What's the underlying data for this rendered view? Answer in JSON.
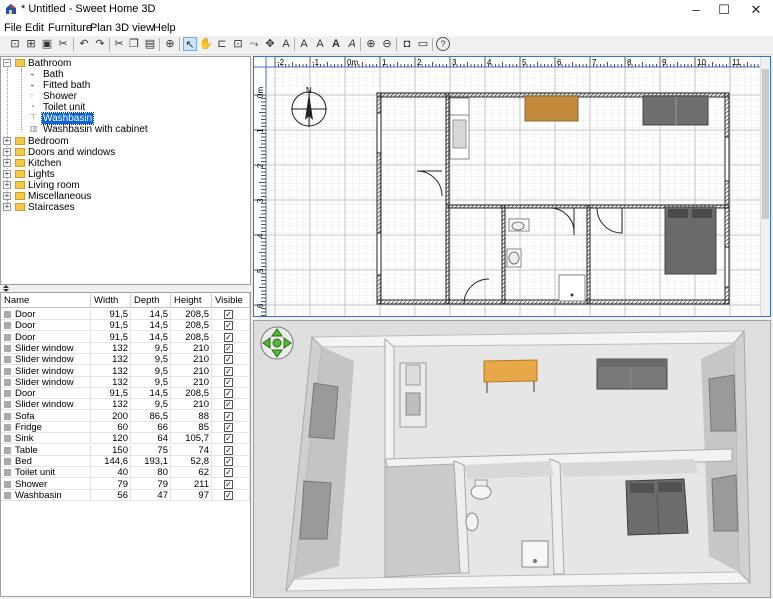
{
  "window": {
    "title": "* Untitled - Sweet Home 3D",
    "minimize": "–",
    "maximize": "☐",
    "close": "✕"
  },
  "menu": [
    "File",
    "Edit",
    "Furniture",
    "Plan",
    "3D view",
    "Help"
  ],
  "toolbar": [
    "new-icon",
    "open-icon",
    "save-icon",
    "cut-icon",
    "undo-icon",
    "redo-icon",
    "add-furniture-icon",
    "select-icon",
    "pan-icon",
    "create-walls-icon",
    "create-rooms-icon",
    "create-dimensions-icon",
    "add-text-icon",
    "zoom-in-icon",
    "zoom-out-icon",
    "camera-icon",
    "help-icon"
  ],
  "catalog": {
    "categories": [
      {
        "label": "Bathroom",
        "expanded": true,
        "items": [
          "Bath",
          "Fitted bath",
          "Shower",
          "Toilet unit",
          "Washbasin",
          "Washbasin with cabinet"
        ]
      },
      {
        "label": "Bedroom"
      },
      {
        "label": "Doors and windows"
      },
      {
        "label": "Kitchen"
      },
      {
        "label": "Lights"
      },
      {
        "label": "Living room"
      },
      {
        "label": "Miscellaneous"
      },
      {
        "label": "Staircases"
      }
    ],
    "selected": "Washbasin"
  },
  "furniture_table": {
    "columns": [
      "Name",
      "Width",
      "Depth",
      "Height",
      "Visible"
    ],
    "rows": [
      [
        "Door",
        "91,5",
        "14,5",
        "208,5",
        "✓"
      ],
      [
        "Door",
        "91,5",
        "14,5",
        "208,5",
        "✓"
      ],
      [
        "Door",
        "91,5",
        "14,5",
        "208,5",
        "✓"
      ],
      [
        "Slider window",
        "132",
        "9,5",
        "210",
        "✓"
      ],
      [
        "Slider window",
        "132",
        "9,5",
        "210",
        "✓"
      ],
      [
        "Slider window",
        "132",
        "9,5",
        "210",
        "✓"
      ],
      [
        "Slider window",
        "132",
        "9,5",
        "210",
        "✓"
      ],
      [
        "Door",
        "91,5",
        "14,5",
        "208,5",
        "✓"
      ],
      [
        "Slider window",
        "132",
        "9,5",
        "210",
        "✓"
      ],
      [
        "Sofa",
        "200",
        "86,5",
        "88",
        "✓"
      ],
      [
        "Fridge",
        "60",
        "66",
        "85",
        "✓"
      ],
      [
        "Sink",
        "120",
        "64",
        "105,7",
        "✓"
      ],
      [
        "Table",
        "150",
        "75",
        "74",
        "✓"
      ],
      [
        "Bed",
        "144,6",
        "193,1",
        "52,8",
        "✓"
      ],
      [
        "Toilet unit",
        "40",
        "80",
        "62",
        "✓"
      ],
      [
        "Shower",
        "79",
        "79",
        "211",
        "✓"
      ],
      [
        "Washbasin",
        "56",
        "47",
        "97",
        "✓"
      ]
    ]
  },
  "plan": {
    "ruler_top": [
      "-2",
      "-1",
      "0m",
      "1",
      "2",
      "3",
      "4",
      "5",
      "6",
      "7",
      "8",
      "9",
      "10",
      "11"
    ],
    "ruler_left": [
      "0m",
      "1",
      "2",
      "3",
      "4",
      "5",
      "6"
    ],
    "compass": "N"
  },
  "colors": {
    "table": "#c08a3a",
    "sofa": "#6e6e6e",
    "bed": "#6a6a6a",
    "selection": "#0a64d8",
    "wall": "#333333"
  }
}
